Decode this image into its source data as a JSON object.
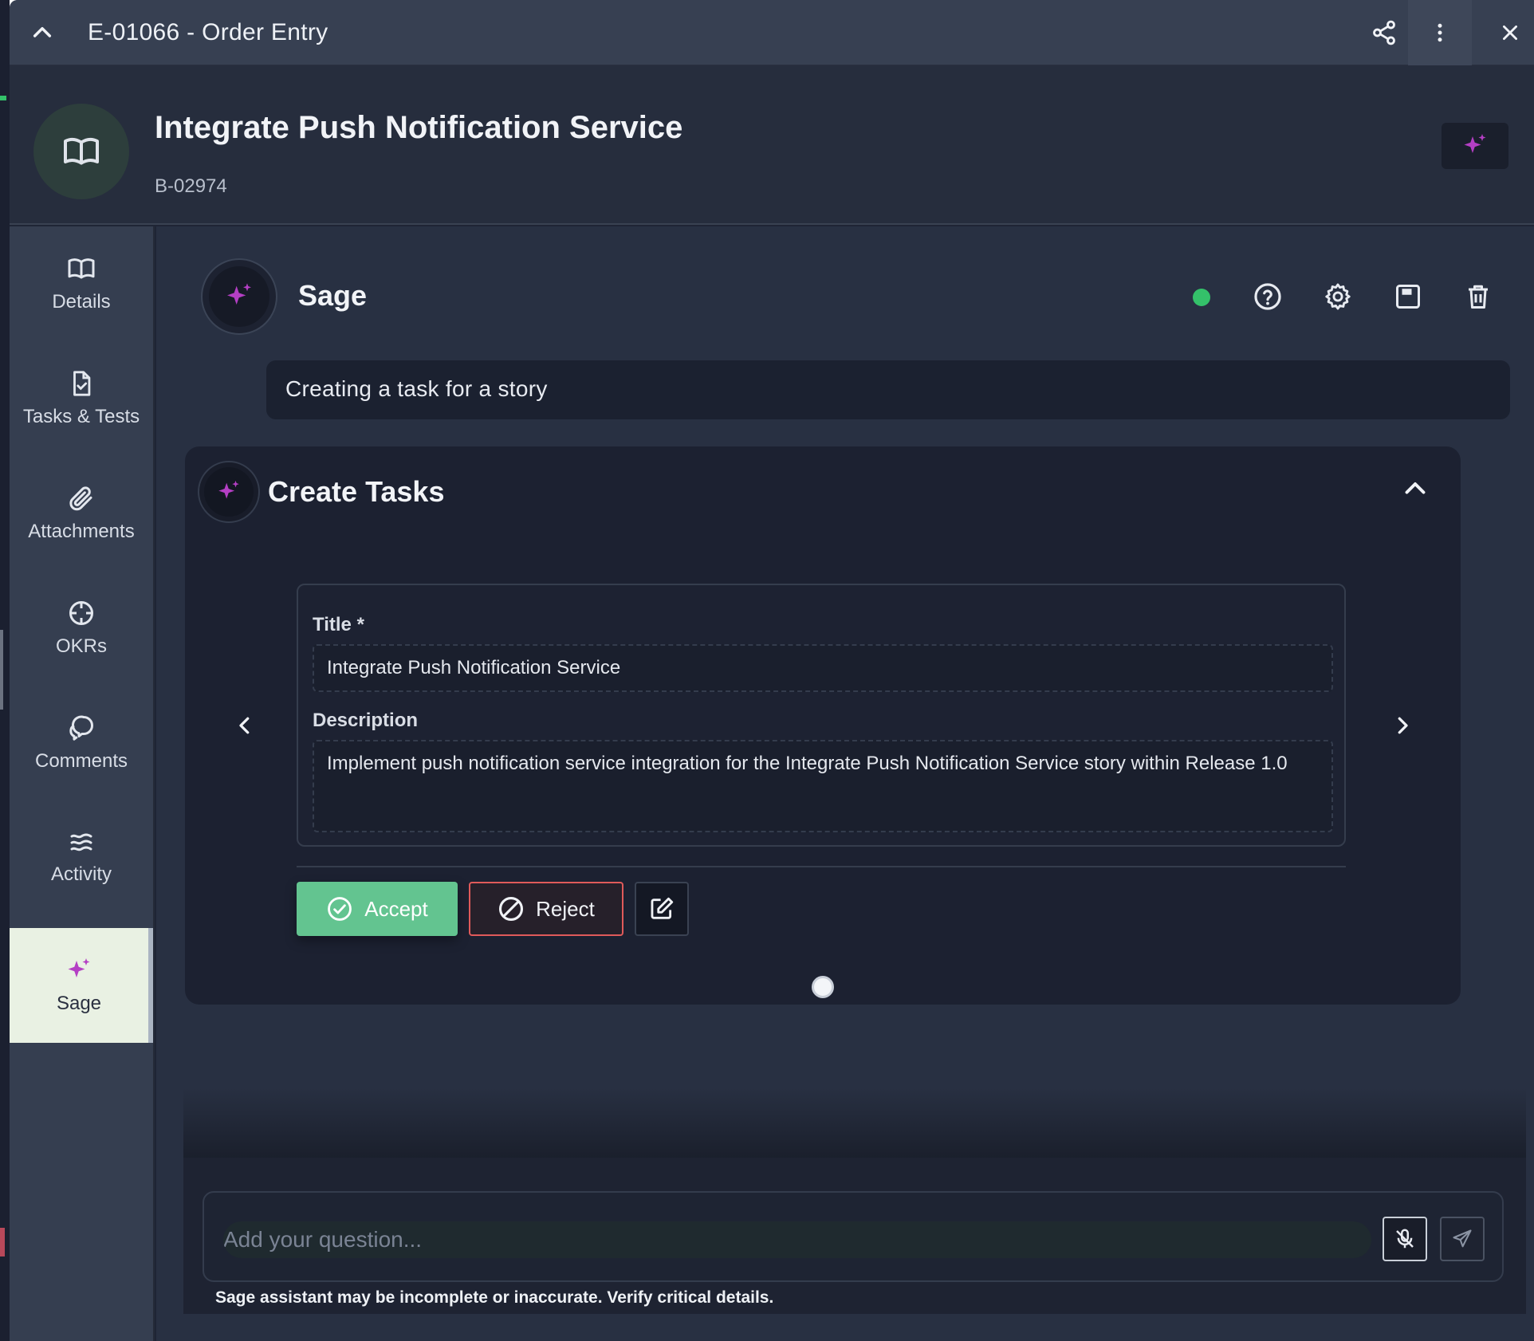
{
  "window": {
    "title": "E-01066 - Order Entry",
    "icons": {
      "collapse": "chevron-up-icon",
      "share": "share-icon",
      "more": "more-vertical-icon",
      "close": "close-icon"
    }
  },
  "header": {
    "title": "Integrate Push Notification Service",
    "id": "B-02974",
    "icon": "book-icon",
    "action_icon": "sparkles-icon"
  },
  "sidebar": {
    "items": [
      {
        "label": "Details",
        "icon": "book-icon",
        "active": false
      },
      {
        "label": "Tasks & Tests",
        "icon": "file-check-icon",
        "active": false
      },
      {
        "label": "Attachments",
        "icon": "paperclip-icon",
        "active": false
      },
      {
        "label": "OKRs",
        "icon": "crosshair-icon",
        "active": false
      },
      {
        "label": "Comments",
        "icon": "chat-bubbles-icon",
        "active": false
      },
      {
        "label": "Activity",
        "icon": "waves-icon",
        "active": false
      },
      {
        "label": "Sage",
        "icon": "sparkles-icon",
        "active": true
      }
    ]
  },
  "sage": {
    "name": "Sage",
    "status": "online",
    "header_icons": [
      "help-icon",
      "gear-icon",
      "save-icon",
      "trash-icon"
    ],
    "prompt": "Creating a task for a story",
    "card": {
      "title": "Create Tasks",
      "task": {
        "title_label": "Title *",
        "title_value": "Integrate Push Notification Service",
        "description_label": "Description",
        "description_value": "Implement push notification service integration for the Integrate Push Notification Service story within Release 1.0"
      },
      "accept_label": "Accept",
      "reject_label": "Reject",
      "page_count": 1,
      "current_page": 1
    },
    "input_placeholder": "Add your question...",
    "disclaimer": "Sage assistant may be incomplete or inaccurate. Verify critical details."
  },
  "colors": {
    "accent": "#b43fc4",
    "accept": "#63c490",
    "reject_border": "#e05a5a",
    "status": "#34c16a",
    "active_nav_bg": "#e9f1e3"
  }
}
